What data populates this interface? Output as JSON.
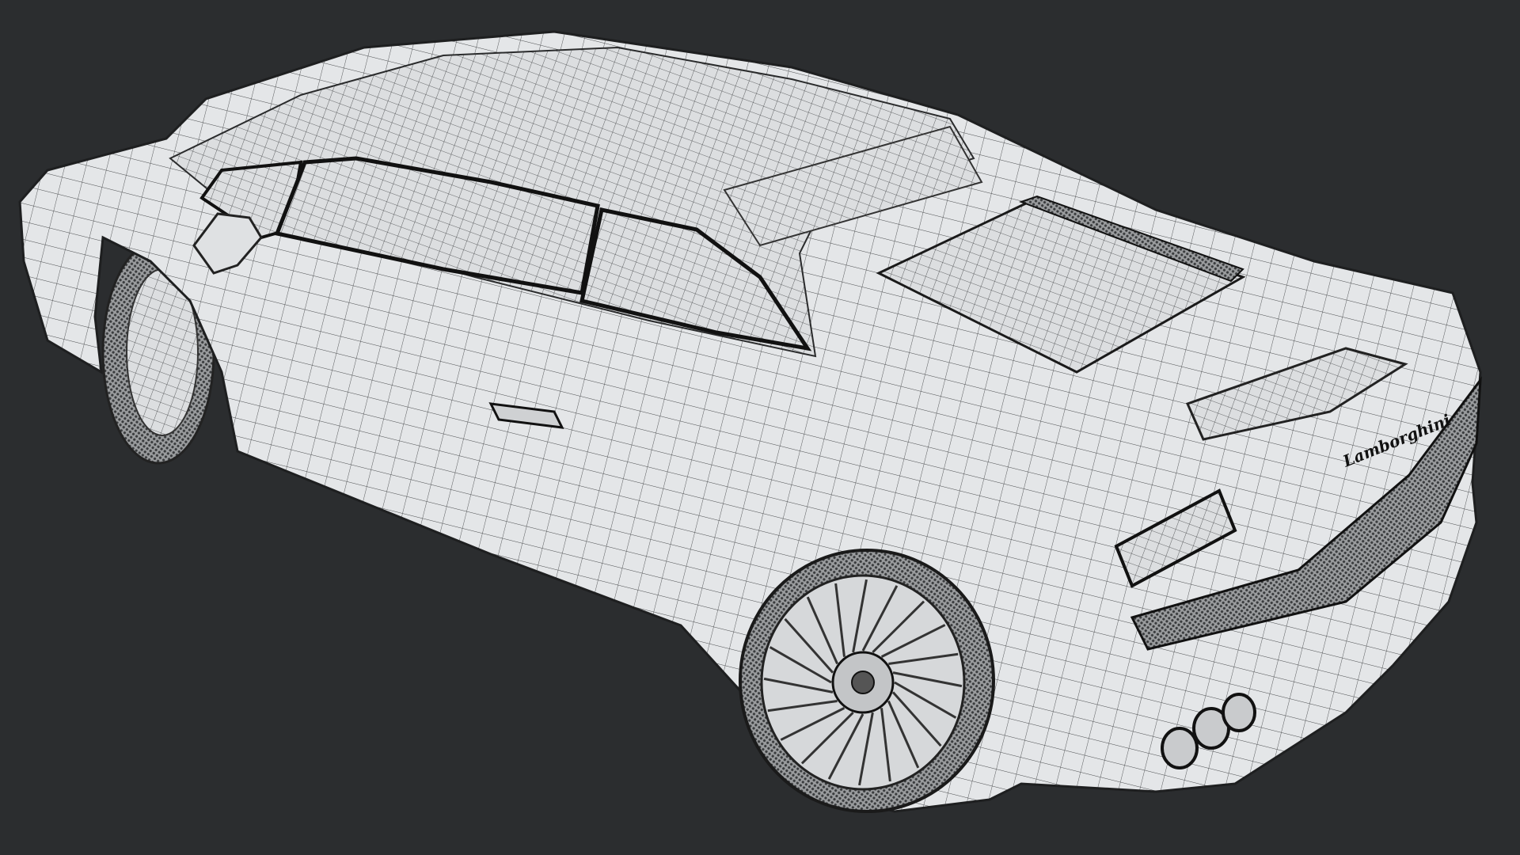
{
  "scene": {
    "subject": "wireframe-car-render",
    "badge_text": "Lamborghini",
    "colors": {
      "background": "#2b2d2f",
      "surface": "#e4e6e8",
      "wire": "#3a3c3e",
      "mesh_dark": "#5a5c5e"
    }
  }
}
